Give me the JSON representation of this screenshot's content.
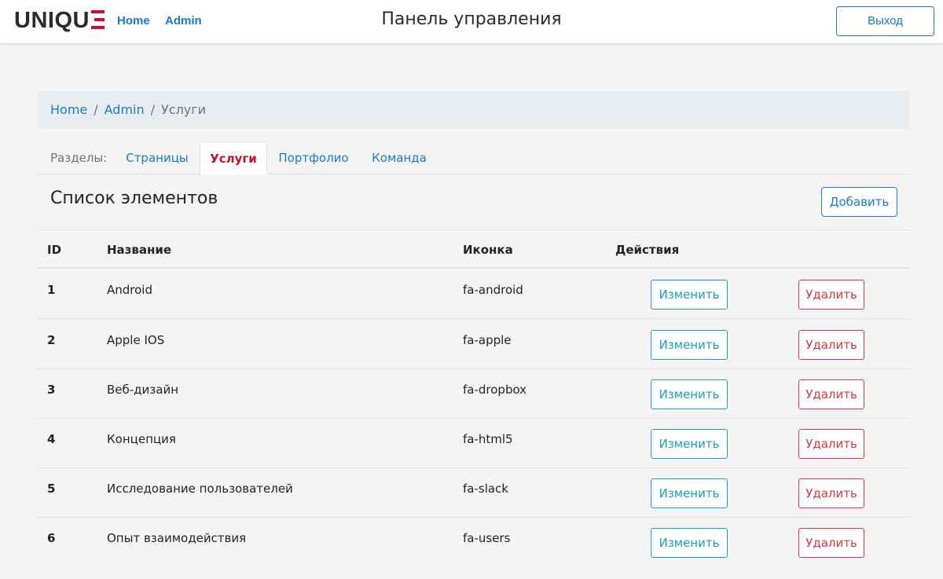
{
  "header": {
    "logo_text": "UNIQU",
    "nav": [
      "Home",
      "Admin"
    ],
    "title": "Панель управления",
    "logout_label": "Выход"
  },
  "breadcrumb": [
    "Home",
    "Admin",
    "Услуги"
  ],
  "tabs": {
    "label": "Разделы:",
    "items": [
      "Страницы",
      "Услуги",
      "Портфолио",
      "Команда"
    ],
    "active": "Услуги"
  },
  "list": {
    "title": "Список элементов",
    "add_label": "Добавить"
  },
  "table": {
    "headers": [
      "ID",
      "Название",
      "Иконка",
      "Действия"
    ],
    "rows": [
      {
        "id": "1",
        "name": "Android",
        "icon": "fa-android"
      },
      {
        "id": "2",
        "name": "Apple IOS",
        "icon": "fa-apple"
      },
      {
        "id": "3",
        "name": "Веб-дизайн",
        "icon": "fa-dropbox"
      },
      {
        "id": "4",
        "name": "Концепция",
        "icon": "fa-html5"
      },
      {
        "id": "5",
        "name": "Исследование пользователей",
        "icon": "fa-slack"
      },
      {
        "id": "6",
        "name": "Опыт взаимодействия",
        "icon": "fa-users"
      }
    ],
    "edit_label": "Изменить",
    "delete_label": "Удалить"
  },
  "colors": {
    "brand_red": "#c8102e",
    "link_blue": "#1b7bd1",
    "edit_teal": "#17a2b8",
    "delete_red": "#dc3545"
  }
}
